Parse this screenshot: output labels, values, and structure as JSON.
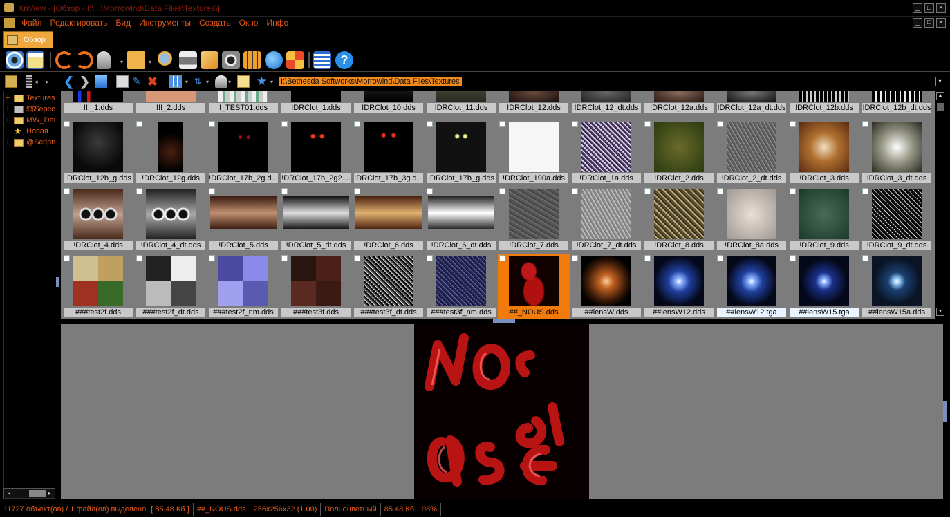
{
  "window": {
    "title": "XnView - [Обзор - I:\\...\\Morrowind\\Data Files\\Textures\\]",
    "buttons": [
      "_",
      "□",
      "×"
    ]
  },
  "menu": {
    "items": [
      "Файл",
      "Редактировать",
      "Вид",
      "Инструменты",
      "Создать",
      "Окно",
      "Инфо"
    ]
  },
  "tab": {
    "label": "Обзор"
  },
  "toolbar": {
    "icons": [
      "eye-icon",
      "notes-icon",
      "rotate-left-icon",
      "rotate-right-icon",
      "filter-icon",
      "open-folder-icon",
      "zoom-image-icon",
      "print-icon",
      "convert-icon",
      "camera-icon",
      "filmstrip-icon",
      "globe-icon",
      "mosaic-icon",
      "list-icon",
      "help-icon"
    ]
  },
  "address": {
    "path": "I:\\Bethesda Softworks\\Morrowind\\Data Files\\Textures"
  },
  "sidebar": {
    "items": [
      {
        "label": "Textures",
        "type": "folder",
        "expand": "+"
      },
      {
        "label": "$$$ерсоп",
        "type": "folder",
        "expand": "+"
      },
      {
        "label": "MW_Data",
        "type": "folder",
        "expand": "+"
      },
      {
        "label": "Новая",
        "type": "star",
        "expand": ""
      },
      {
        "label": "@Scripts",
        "type": "folder",
        "expand": "+"
      }
    ]
  },
  "thumbnails": {
    "row0": [
      "!!!_1.dds",
      "!!!_2.dds",
      "!_TEST01.dds",
      "!DRClot_1.dds",
      "!DRClot_10.dds",
      "!DRClot_11.dds",
      "!DRClot_12.dds",
      "!DRClot_12_dt.dds",
      "!DRClot_12a.dds",
      "!DRClot_12a_dt.dds",
      "!DRClot_12b.dds",
      "!DRClot_12b_dt.dds"
    ],
    "row1": [
      "!DRClot_12b_g.dds",
      "!DRClot_12g.dds",
      "!DRClot_17b_2g.d...",
      "!DRClot_17b_2g2....",
      "!DRClot_17b_3g.d...",
      "!DRClot_17b_g.dds",
      "!DRClot_190a.dds",
      "!DRClot_1a.dds",
      "!DRClot_2.dds",
      "!DRClot_2_dt.dds",
      "!DRClot_3.dds",
      "!DRClot_3_dt.dds"
    ],
    "row2": [
      "!DRClot_4.dds",
      "!DRClot_4_dt.dds",
      "!DRClot_5.dds",
      "!DRClot_5_dt.dds",
      "!DRClot_6.dds",
      "!DRClot_6_dt.dds",
      "!DRClot_7.dds",
      "!DRClot_7_dt.dds",
      "!DRClot_8.dds",
      "!DRClot_8a.dds",
      "!DRClot_9.dds",
      "!DRClot_9_dt.dds"
    ],
    "row3": [
      "###test2f.dds",
      "###test2f_dt.dds",
      "###test2f_nm.dds",
      "###test3f.dds",
      "###test3f_dt.dds",
      "###test3f_nm.dds",
      "##_NOUS.dds",
      "##lensW.dds",
      "##lensW12.dds",
      "##lensW12.tga",
      "##lensW15.tga",
      "##lensW15a.dds"
    ],
    "selected": "##_NOUS.dds"
  },
  "statusbar": {
    "count": "11727 объект(ов) / 1 файл(ов) выделено",
    "size": "[ 85.48 Кб ]",
    "filename": "##_NOUS.dds",
    "dimensions": "256x256x32 (1.00)",
    "colormode": "Полноцветный",
    "filesize": "85.48 Кб",
    "zoom": "98%"
  }
}
